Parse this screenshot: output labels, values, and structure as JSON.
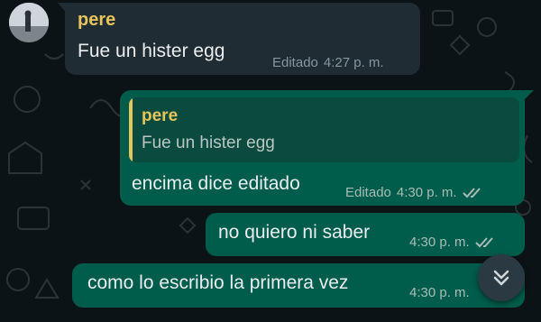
{
  "conversation": {
    "incoming": {
      "sender": "pere",
      "text": "Fue un hister egg",
      "edited_label": "Editado",
      "time": "4:27 p. m."
    },
    "outgoing": [
      {
        "quote_sender": "pere",
        "quote_text": "Fue un hister egg",
        "text": "encima dice editado",
        "edited_label": "Editado",
        "time": "4:30 p. m."
      },
      {
        "text": "no quiero ni saber",
        "time": "4:30 p. m."
      },
      {
        "text": "como lo escribio la primera vez",
        "time": "4:30 p. m."
      }
    ]
  },
  "icons": {
    "read_receipt": "double-check-icon",
    "scroll_down": "double-chevron-down-icon",
    "avatar": "avatar"
  },
  "colors": {
    "background": "#0c1317",
    "incoming_bubble": "#1f2c34",
    "outgoing_bubble": "#005c4b",
    "sender_name": "#e6c55b",
    "read_tick": "#a8bcb6"
  }
}
